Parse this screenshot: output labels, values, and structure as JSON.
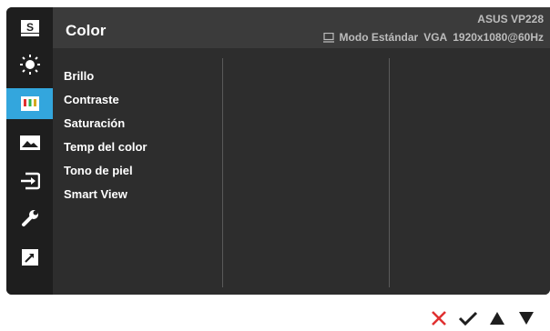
{
  "header": {
    "title": "Color",
    "model": "ASUS  VP228",
    "mode": "Modo Estándar",
    "input": "VGA",
    "resolution": "1920x1080@60Hz"
  },
  "sidebar": {
    "items": [
      {
        "icon": "splendid-s-icon"
      },
      {
        "icon": "brightness-sun-icon"
      },
      {
        "icon": "color-bars-icon",
        "active": true
      },
      {
        "icon": "image-icon"
      },
      {
        "icon": "input-select-icon"
      },
      {
        "icon": "wrench-icon"
      },
      {
        "icon": "shortcut-arrow-icon"
      }
    ]
  },
  "menu": {
    "items": [
      "Brillo",
      "Contraste",
      "Saturación",
      "Temp del color",
      "Tono de piel",
      "Smart View"
    ]
  },
  "keys": {
    "close": "close-x-icon",
    "confirm": "checkmark-icon",
    "up": "up-arrow-icon",
    "down": "down-arrow-icon"
  },
  "colors": {
    "accent": "#33a6dd",
    "close": "#e03030",
    "panel": "#2d2d2d",
    "header": "#3b3b3b"
  }
}
